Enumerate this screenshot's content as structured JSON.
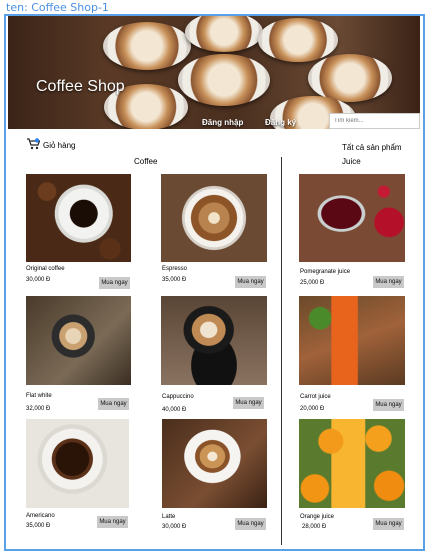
{
  "frame_label": "ten: Coffee Shop-1",
  "header": {
    "title": "Coffee Shop",
    "login": "Đăng nhập",
    "register": "Đăng ký",
    "search_placeholder": "Tìm kiếm..."
  },
  "cart_label": "Giỏ hàng",
  "all_products": "Tất cả sản phẩm",
  "sections": {
    "coffee": "Coffee",
    "juice": "Juice"
  },
  "buy_label": "Mua ngay",
  "products": [
    {
      "name": "Original coffee",
      "price": "30,000 Đ"
    },
    {
      "name": "Espresso",
      "price": "35,000 Đ"
    },
    {
      "name": "Pomegranate juice",
      "price": "25,000 Đ"
    },
    {
      "name": "Flat white",
      "price": "32,000 Đ"
    },
    {
      "name": "Cappuccino",
      "price": "40,000 Đ"
    },
    {
      "name": "Carrot juice",
      "price": "20,000 Đ"
    },
    {
      "name": "Americano",
      "price": "35,000 Đ"
    },
    {
      "name": "Latte",
      "price": "30,000 Đ"
    },
    {
      "name": "Orange juice",
      "price": "28,000 Đ"
    }
  ]
}
